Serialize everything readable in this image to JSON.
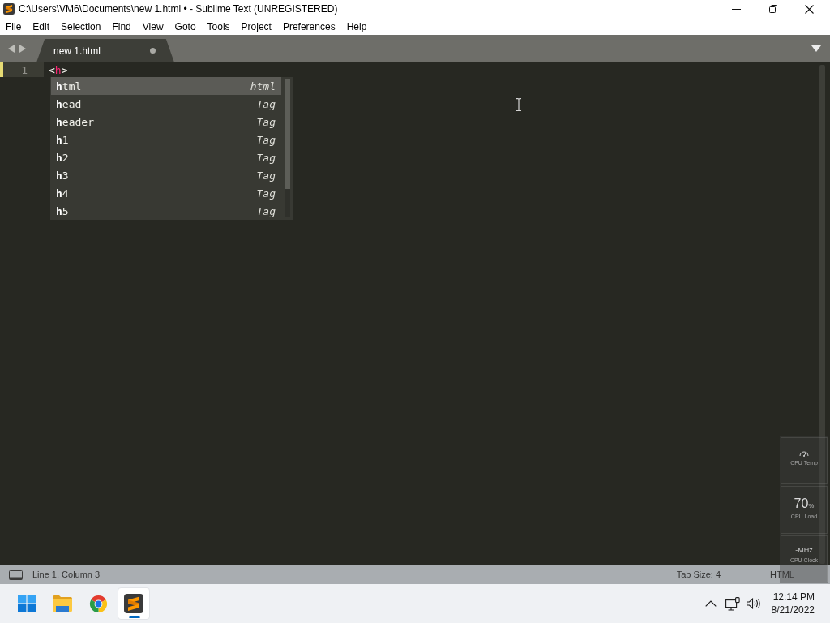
{
  "window": {
    "title": "C:\\Users\\VM6\\Documents\\new 1.html • - Sublime Text (UNREGISTERED)"
  },
  "menu": [
    "File",
    "Edit",
    "Selection",
    "Find",
    "View",
    "Goto",
    "Tools",
    "Project",
    "Preferences",
    "Help"
  ],
  "tabs": [
    {
      "label": "new 1.html",
      "selected": true,
      "modified": true
    }
  ],
  "editor": {
    "lines": [
      {
        "number": "1",
        "current": true,
        "modified": true,
        "tokens": [
          {
            "kind": "punctuation",
            "text": "<"
          },
          {
            "kind": "tag",
            "text": "h"
          },
          {
            "kind": "punctuation",
            "text": ">"
          }
        ]
      }
    ]
  },
  "autocomplete": {
    "items": [
      {
        "label": "**h**tml",
        "hint": "html",
        "selected": true
      },
      {
        "label": "**h**ead",
        "hint": "Tag",
        "selected": false
      },
      {
        "label": "**h**eader",
        "hint": "Tag",
        "selected": false
      },
      {
        "label": "**h**1",
        "hint": "Tag",
        "selected": false
      },
      {
        "label": "**h**2",
        "hint": "Tag",
        "selected": false
      },
      {
        "label": "**h**3",
        "hint": "Tag",
        "selected": false
      },
      {
        "label": "**h**4",
        "hint": "Tag",
        "selected": false
      },
      {
        "label": "**h**5",
        "hint": "Tag",
        "selected": false
      }
    ]
  },
  "status_bar": {
    "position": "Line 1, Column 3",
    "tab_size": "Tab Size: 4",
    "syntax": "HTML"
  },
  "gadget": {
    "panels": [
      {
        "kind": "icon",
        "label": "CPU Temp"
      },
      {
        "kind": "reading",
        "value": "70",
        "unit": "%",
        "label": "CPU Load"
      },
      {
        "kind": "text",
        "reading": "-MHz",
        "label": "CPU Clock"
      }
    ]
  },
  "taskbar": {
    "apps": [
      {
        "kind": "start",
        "selected": false
      },
      {
        "kind": "files",
        "selected": false
      },
      {
        "kind": "browser",
        "selected": false
      },
      {
        "kind": "editor",
        "selected": true
      }
    ],
    "clock": {
      "time": "12:14 PM",
      "date": "8/21/2022"
    }
  }
}
